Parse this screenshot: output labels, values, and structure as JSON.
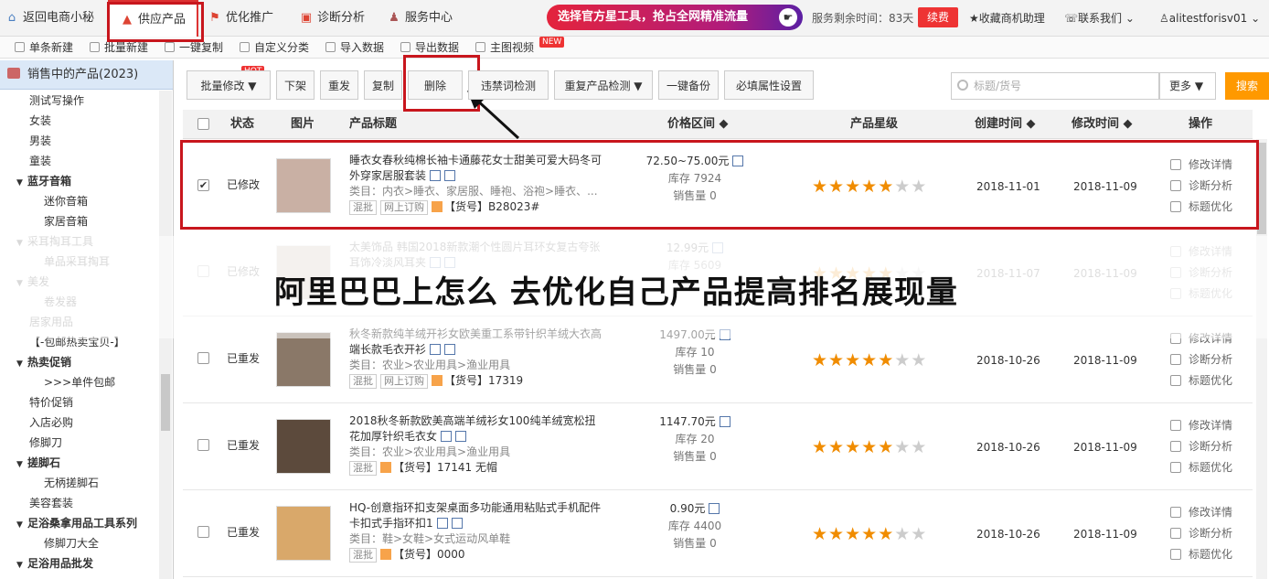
{
  "topnav": {
    "items": [
      {
        "label": "返回电商小秘",
        "icon": "home-icon"
      },
      {
        "label": "供应产品",
        "icon": "supply-icon"
      },
      {
        "label": "优化推广",
        "icon": "flag-icon"
      },
      {
        "label": "诊断分析",
        "icon": "diagnose-icon"
      },
      {
        "label": "服务中心",
        "icon": "service-icon"
      }
    ],
    "banner": "选择官方星工具，抢占全网精准流量",
    "service_time": "服务剩余时间：83天",
    "renew": "续费",
    "favorite": "★收藏商机助理",
    "contact": "联系我们 ⌄",
    "user": "alitestforisv01 ⌄"
  },
  "subbar": {
    "items": [
      "单条新建",
      "批量新建",
      "一键复制",
      "自定义分类",
      "导入数据",
      "导出数据",
      "主图视频"
    ],
    "new_badge": "NEW"
  },
  "sidebar": {
    "header": "销售中的产品(2023)",
    "items": [
      {
        "label": "测试写操作",
        "indent": 1,
        "style": ""
      },
      {
        "label": "女装",
        "indent": 1,
        "style": ""
      },
      {
        "label": "男装",
        "indent": 1,
        "style": ""
      },
      {
        "label": "童装",
        "indent": 1,
        "style": ""
      },
      {
        "label": "蓝牙音箱",
        "indent": 0,
        "style": "bold"
      },
      {
        "label": "迷你音箱",
        "indent": 2,
        "style": ""
      },
      {
        "label": "家居音箱",
        "indent": 2,
        "style": ""
      },
      {
        "label": "采耳掏耳工具",
        "indent": 0,
        "style": "dim"
      },
      {
        "label": "单品采耳掏耳",
        "indent": 2,
        "style": "dim"
      },
      {
        "label": "美发",
        "indent": 0,
        "style": "dim"
      },
      {
        "label": "卷发器",
        "indent": 2,
        "style": "dim"
      },
      {
        "label": "居家用品",
        "indent": 1,
        "style": "dim"
      },
      {
        "label": "【-包邮热卖宝贝-】",
        "indent": 1,
        "style": ""
      },
      {
        "label": "热卖促销",
        "indent": 0,
        "style": "bold"
      },
      {
        "label": ">>>单件包邮",
        "indent": 2,
        "style": ""
      },
      {
        "label": "特价促销",
        "indent": 1,
        "style": ""
      },
      {
        "label": "入店必购",
        "indent": 1,
        "style": ""
      },
      {
        "label": "修脚刀",
        "indent": 1,
        "style": ""
      },
      {
        "label": "搓脚石",
        "indent": 0,
        "style": "bold"
      },
      {
        "label": "无柄搓脚石",
        "indent": 2,
        "style": ""
      },
      {
        "label": "美容套装",
        "indent": 1,
        "style": ""
      },
      {
        "label": "足浴桑拿用品工具系列",
        "indent": 0,
        "style": "bold"
      },
      {
        "label": "修脚刀大全",
        "indent": 2,
        "style": ""
      },
      {
        "label": "足浴用品批发",
        "indent": 0,
        "style": "bold"
      }
    ]
  },
  "toolbar": {
    "buttons": [
      "批量修改 ▼",
      "下架",
      "重发",
      "复制",
      "删除",
      "违禁词检测",
      "重复产品检测 ▼",
      "一键备份",
      "必填属性设置"
    ],
    "hot_badge": "HOT",
    "search_placeholder": "标题/货号",
    "more": "更多 ▼",
    "search": "搜索"
  },
  "table": {
    "headers": {
      "status": "状态",
      "image": "图片",
      "title": "产品标题",
      "price": "价格区间 ◆",
      "stars": "产品星级",
      "created": "创建时间 ◆",
      "modified": "修改时间 ◆",
      "ops": "操作"
    },
    "rows": [
      {
        "status": "已修改",
        "title": "睡衣女春秋纯棉长袖卡通藤花女士甜美可爱大码冬可外穿家居服套装",
        "category": "类目：内衣>睡衣、家居服、睡袍、浴袍>睡衣、...",
        "tags": [
          "混批",
          "网上订购"
        ],
        "sku": "【货号】B28023#",
        "price": "72.50~75.00元",
        "stock": "库存 7924",
        "sold": "销售量 0",
        "stars": 5,
        "created": "2018-11-01",
        "modified": "2018-11-09",
        "checked": true,
        "faded": false,
        "thumb": "#c9b0a4"
      },
      {
        "status": "已修改",
        "title": "太美饰品 韩国2018新款潮个性圆片耳环女复古夸张耳饰冷淡风耳夹",
        "category": "",
        "tags": [],
        "sku": "",
        "price": "12.99元",
        "stock": "库存 5609",
        "sold": "",
        "stars": 5,
        "created": "2018-11-07",
        "modified": "2018-11-09",
        "checked": false,
        "faded": true,
        "thumb": "#b8a898"
      },
      {
        "status": "已重发",
        "title": "秋冬新款纯羊绒开衫女欧美重工系带针织羊绒大衣高端长款毛衣开衫",
        "category": "类目：农业>农业用具>渔业用具",
        "tags": [
          "混批",
          "网上订购"
        ],
        "sku": "【货号】17319",
        "price": "1497.00元",
        "stock": "库存 10",
        "sold": "销售量 0",
        "stars": 5,
        "created": "2018-10-26",
        "modified": "2018-11-09",
        "checked": false,
        "faded": false,
        "thumb": "#8a7868"
      },
      {
        "status": "已重发",
        "title": "2018秋冬新款欧美高端羊绒衫女100纯羊绒宽松扭花加厚针织毛衣女",
        "category": "类目：农业>农业用具>渔业用具",
        "tags": [
          "混批"
        ],
        "sku": "【货号】17141 无帽",
        "price": "1147.70元",
        "stock": "库存 20",
        "sold": "销售量 0",
        "stars": 5,
        "created": "2018-10-26",
        "modified": "2018-11-09",
        "checked": false,
        "faded": false,
        "thumb": "#5c4a3c"
      },
      {
        "status": "已重发",
        "title": "HQ-创意指环扣支架桌面多功能通用粘贴式手机配件卡扣式手指环扣1",
        "category": "类目：鞋>女鞋>女式运动风单鞋",
        "tags": [
          "混批"
        ],
        "sku": "【货号】0000",
        "price": "0.90元",
        "stock": "库存 4400",
        "sold": "销售量 0",
        "stars": 5,
        "created": "2018-10-26",
        "modified": "2018-11-09",
        "checked": false,
        "faded": false,
        "thumb": "#d9a86a"
      }
    ],
    "ops": [
      "修改详情",
      "诊断分析",
      "标题优化"
    ]
  },
  "overlay_caption": "阿里巴巴上怎么 去优化自己产品提高排名展现量",
  "colors": {
    "accent_red": "#c8161d",
    "star": "#f08c00",
    "search": "#ff9900"
  }
}
